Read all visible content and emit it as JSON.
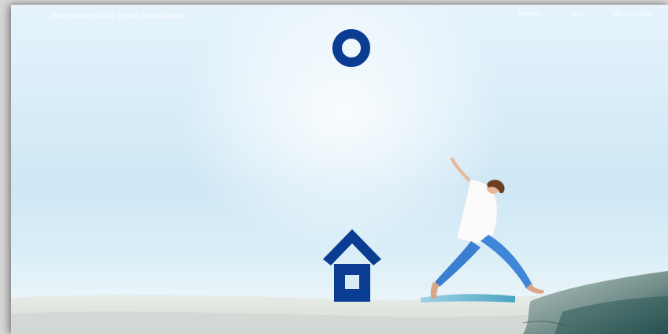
{
  "header": {
    "brand_label": "European Holiday Home Association",
    "nav": {
      "members": "Members",
      "news": "News",
      "about_contact": "About & Contact"
    }
  },
  "icons": {
    "logo_ring": "ring-logo-icon",
    "house": "house-logo-icon"
  },
  "colors": {
    "brand_blue": "#0a3d91",
    "nav_text": "#ffffff",
    "sky": "#d7ecf8"
  }
}
